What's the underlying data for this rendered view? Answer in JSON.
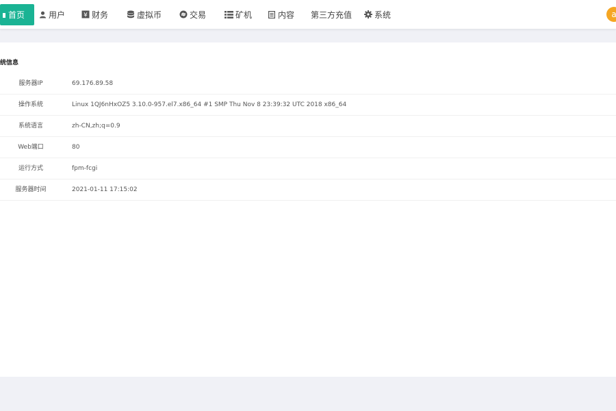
{
  "nav": {
    "items": [
      {
        "label": "首页",
        "icon": "home-icon"
      },
      {
        "label": "用户",
        "icon": "user-icon"
      },
      {
        "label": "财务",
        "icon": "finance-icon"
      },
      {
        "label": "虚拟币",
        "icon": "database-icon"
      },
      {
        "label": "交易",
        "icon": "exchange-icon"
      },
      {
        "label": "矿机",
        "icon": "list-icon"
      },
      {
        "label": "内容",
        "icon": "document-icon"
      },
      {
        "label": "第三方充值",
        "icon": ""
      },
      {
        "label": "系统",
        "icon": "gear-icon"
      }
    ],
    "active_color": "#1ab394",
    "avatar_initial": "a",
    "avatar_color": "#f5a623"
  },
  "panel": {
    "title": "统信息",
    "rows": [
      {
        "label": "服务器IP",
        "value": "69.176.89.58"
      },
      {
        "label": "操作系统",
        "value": "Linux 1QJ6nHxOZ5 3.10.0-957.el7.x86_64 #1 SMP Thu Nov 8 23:39:32 UTC 2018 x86_64"
      },
      {
        "label": "系统语言",
        "value": "zh-CN,zh;q=0.9"
      },
      {
        "label": "Web端口",
        "value": "80"
      },
      {
        "label": "运行方式",
        "value": "fpm-fcgi"
      },
      {
        "label": "服务器时间",
        "value": "2021-01-11 17:15:02"
      }
    ]
  }
}
